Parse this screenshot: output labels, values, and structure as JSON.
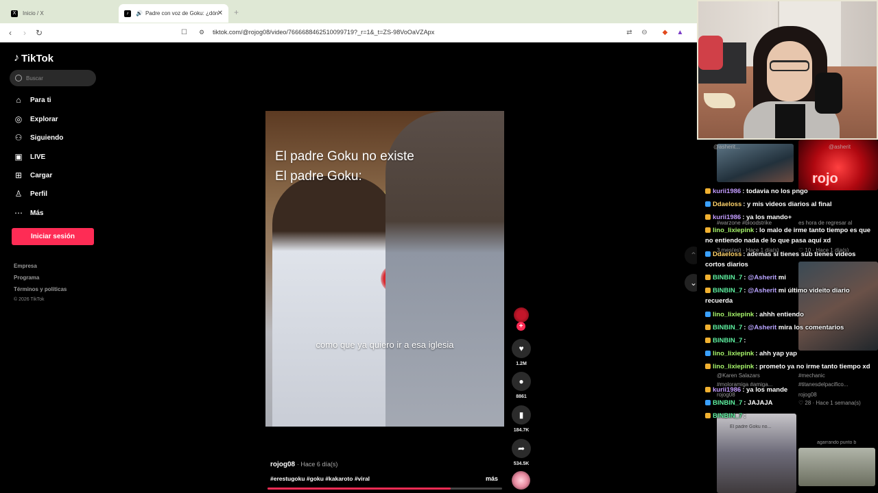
{
  "browser": {
    "tabs": [
      {
        "label": "Inicio / X",
        "icon": "x-logo"
      },
      {
        "label": "Padre con voz de Goku: ¿dón",
        "icon": "tiktok-logo"
      }
    ],
    "address": "tiktok.com/@rojog08/video/7666688462510099719?_r=1&_t=ZS-98VoOaVZApx"
  },
  "sidebar": {
    "logo": "TikTok",
    "search_placeholder": "Buscar",
    "nav": [
      {
        "label": "Para ti",
        "icon": "home-icon"
      },
      {
        "label": "Explorar",
        "icon": "compass-icon"
      },
      {
        "label": "Siguiendo",
        "icon": "following-icon"
      },
      {
        "label": "LIVE",
        "icon": "live-icon"
      },
      {
        "label": "Cargar",
        "icon": "upload-icon"
      },
      {
        "label": "Perfil",
        "icon": "profile-icon"
      },
      {
        "label": "Más",
        "icon": "more-icon"
      }
    ],
    "login": "Iniciar sesión",
    "footer": [
      "Empresa",
      "Programa",
      "Términos y políticas"
    ],
    "copyright": "© 2026 TikTok"
  },
  "video": {
    "overlay_line1": "El padre Goku no existe",
    "overlay_line2": "El padre Goku:",
    "caption": "como que ya quiero ir a esa iglesia",
    "likes": "1.2M",
    "comments": "8861",
    "saves": "184.7K",
    "shares": "534.5K",
    "author": "rojog08",
    "posted": "· Hace 6 día(s)",
    "hashtags": "#erestugoku #goku #kakaroto #viral",
    "more": "más",
    "progress": 0.78
  },
  "stream_overlay": {
    "thumb_brand": "rojo",
    "faint_texts": {
      "tag1": "@asherit...",
      "tag2": "@asherit",
      "hash1": "#warzone #bloodstrike",
      "hash2": "es hora de regresar al",
      "meta1": "3 mes(es) · Hace 1 día(s)",
      "meta2": "♡ 10 · Hace 1 día(s)",
      "ka1": "@Karen Salazars",
      "ka2": "#moloramiga #amiga...",
      "ka3": "rojog08",
      "me1": "#mechanic",
      "me2": "#titanesdelpacifico...",
      "me3": "rojog08",
      "me4": "♡ 28 · Hace 1 semana(s)",
      "ag": "agarrando punto b",
      "pgoku": "El padre Goku no..."
    },
    "chat": [
      {
        "user": "kurii1986",
        "color": "#c39cff",
        "text": ": todavia no los pngo"
      },
      {
        "user": "Ddaeloss",
        "color": "#ffd36b",
        "text": ": y mis videos diarios al final"
      },
      {
        "user": "kurii1986",
        "color": "#c39cff",
        "text": ": ya los mando+"
      },
      {
        "user": "lino_lixiepink",
        "color": "#a7f56b",
        "text": ": lo malo de irme tanto tiempo es que no entiendo nada de lo que pasa aquí xd"
      },
      {
        "user": "Ddaeloss",
        "color": "#ffd36b",
        "text": ": ademas si tienes sub tienes videos cortos diarios"
      },
      {
        "user": "BINBIN_7",
        "color": "#5ef0a0",
        "mention": "@Asherit",
        "text": " mi"
      },
      {
        "user": "BINBIN_7",
        "color": "#5ef0a0",
        "mention": "@Asherit",
        "text": " mi último videito diario recuerda"
      },
      {
        "user": "lino_lixiepink",
        "color": "#a7f56b",
        "text": ": ahhh entiendo"
      },
      {
        "user": "BINBIN_7",
        "color": "#5ef0a0",
        "mention": "@Asherit",
        "text": " mira los comentarios"
      },
      {
        "user": "BINBIN_7",
        "color": "#5ef0a0",
        "text": ":"
      },
      {
        "user": "lino_lixiepink",
        "color": "#a7f56b",
        "text": ": ahh yap yap"
      },
      {
        "user": "lino_lixiepink",
        "color": "#a7f56b",
        "text": ": prometo ya no irme tanto tiempo xd"
      },
      {
        "user": "kurii1986",
        "color": "#c39cff",
        "text": ": ya los mande"
      },
      {
        "user": "BINBIN_7",
        "color": "#5ef0a0",
        "text": ": JAJAJA"
      },
      {
        "user": "BINBIN_7",
        "color": "#5ef0a0",
        "text": ":"
      }
    ]
  }
}
